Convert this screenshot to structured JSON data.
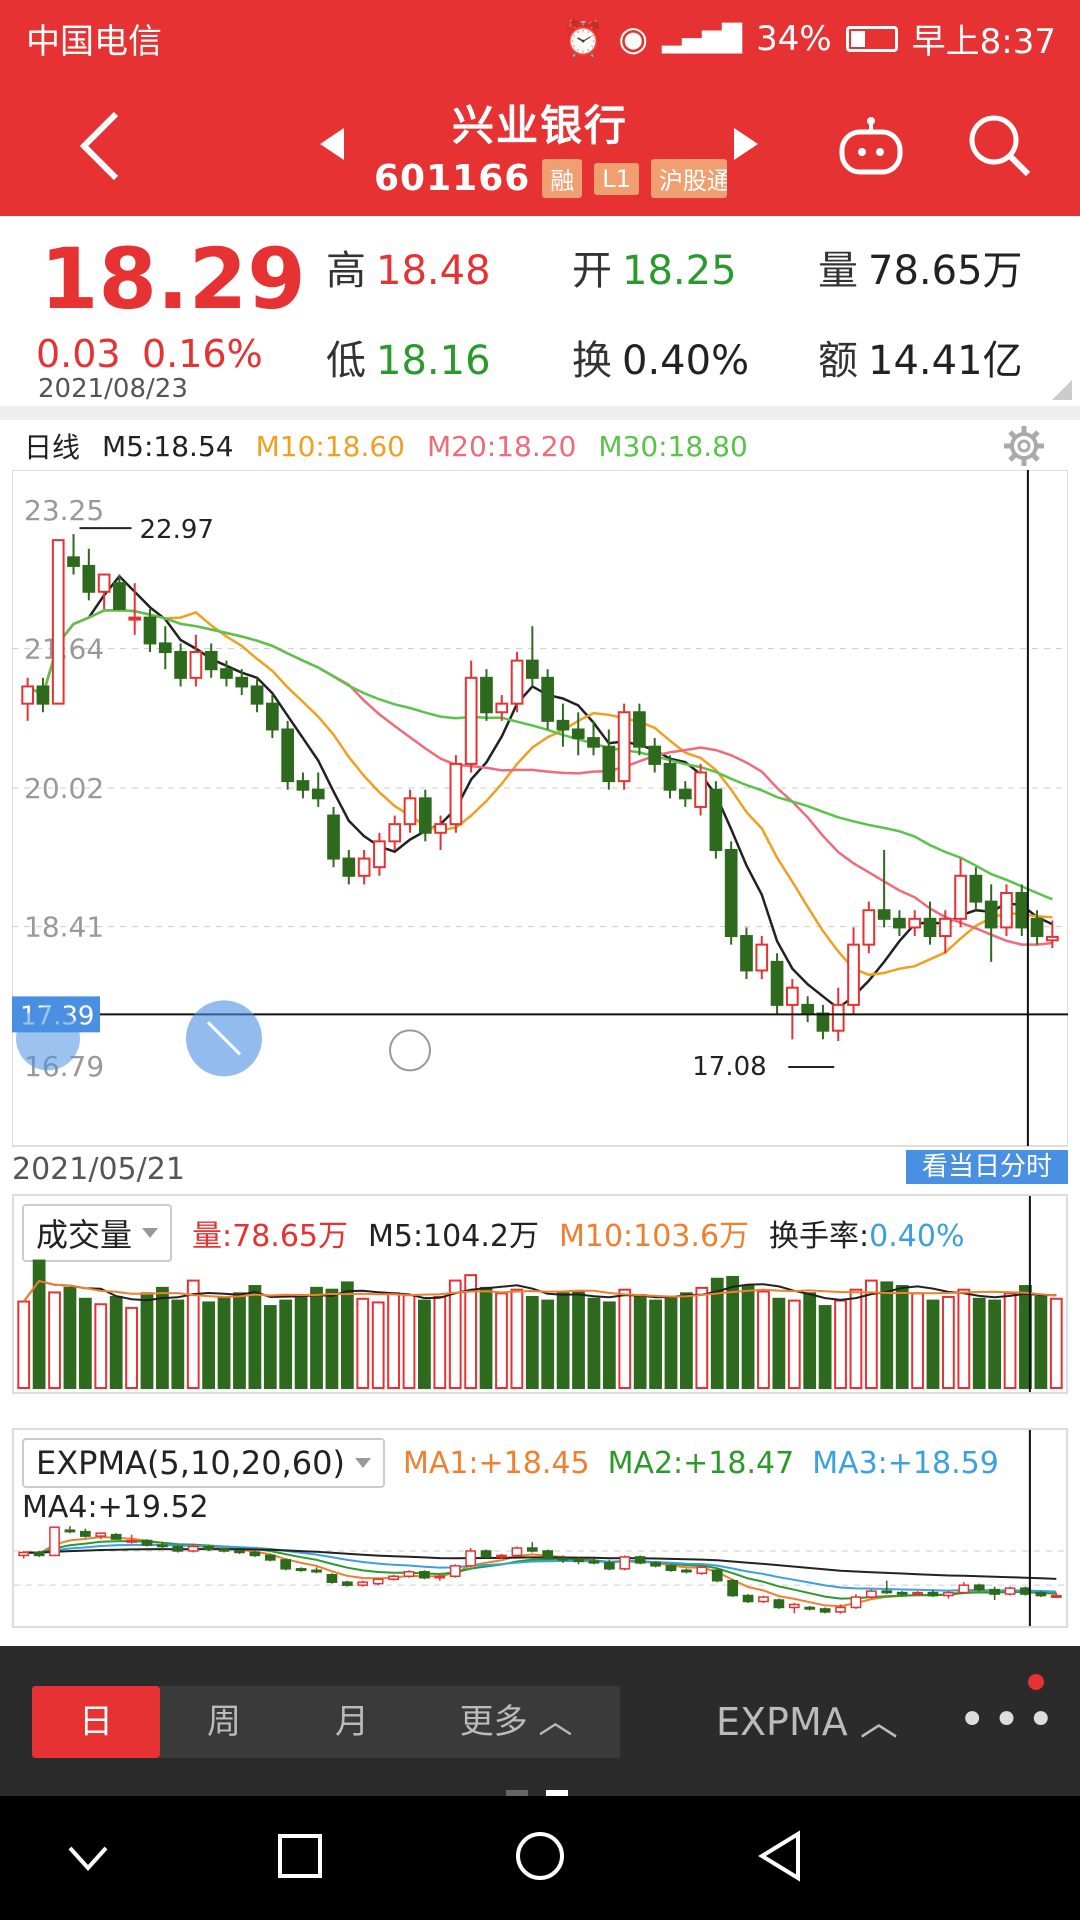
{
  "status": {
    "carrier": "中国电信",
    "battery": "34%",
    "time": "早上8:37"
  },
  "header": {
    "name": "兴业银行",
    "code": "601166",
    "tags": [
      "融",
      "L1",
      "沪股通"
    ]
  },
  "quote": {
    "price": "18.29",
    "change": "0.03",
    "change_pct": "0.16%",
    "date": "2021/08/23",
    "high_label": "高",
    "high": "18.48",
    "open_label": "开",
    "open": "18.25",
    "vol_label": "量",
    "vol": "78.65万",
    "low_label": "低",
    "low": "18.16",
    "turn_label": "换",
    "turn": "0.40%",
    "amt_label": "额",
    "amt": "14.41亿"
  },
  "kline": {
    "period": "日线",
    "m5": "M5:18.54",
    "m10": "M10:18.60",
    "m20": "M20:18.20",
    "m30": "M30:18.80",
    "y_labels": [
      "23.25",
      "21.64",
      "20.02",
      "18.41",
      "16.79"
    ],
    "max_label": "22.97",
    "min_label": "17.08",
    "cursor_price": "17.39",
    "start_date": "2021/05/21",
    "intraday_btn": "看当日分时",
    "colors": {
      "m5": "#222222",
      "m10": "#f0a020",
      "m20": "#f06b7a",
      "m30": "#5ac44a"
    }
  },
  "volume": {
    "selector": "成交量",
    "vol": "量:78.65万",
    "m5": "M5:104.2万",
    "m10": "M10:103.6万",
    "turn_label": "换手率:",
    "turn": "0.40%"
  },
  "expma": {
    "selector": "EXPMA(5,10,20,60)",
    "ma1": "MA1:+18.45",
    "ma2": "MA2:+18.47",
    "ma3": "MA3:+18.59",
    "ma4": "MA4:+19.52"
  },
  "bottom": {
    "day": "日",
    "week": "周",
    "month": "月",
    "more": "更多",
    "indicator": "EXPMA"
  },
  "chart_data": {
    "type": "candlestick",
    "title": "",
    "ylim": [
      16.79,
      23.25
    ],
    "y_ticks": [
      23.25,
      21.64,
      20.02,
      18.41,
      16.79
    ],
    "candles": [
      [
        21.0,
        21.3,
        20.8,
        21.2
      ],
      [
        21.2,
        21.3,
        20.9,
        21.0
      ],
      [
        21.0,
        22.9,
        21.0,
        22.9
      ],
      [
        22.7,
        22.97,
        22.5,
        22.6
      ],
      [
        22.6,
        22.8,
        22.2,
        22.3
      ],
      [
        22.3,
        22.5,
        22.1,
        22.5
      ],
      [
        22.4,
        22.5,
        22.1,
        22.1
      ],
      [
        22.0,
        22.4,
        21.8,
        22.0
      ],
      [
        22.0,
        22.1,
        21.6,
        21.7
      ],
      [
        21.7,
        21.9,
        21.4,
        21.6
      ],
      [
        21.6,
        21.7,
        21.2,
        21.3
      ],
      [
        21.3,
        21.8,
        21.2,
        21.6
      ],
      [
        21.6,
        21.7,
        21.3,
        21.4
      ],
      [
        21.4,
        21.5,
        21.2,
        21.3
      ],
      [
        21.3,
        21.4,
        21.1,
        21.2
      ],
      [
        21.2,
        21.3,
        20.9,
        21.0
      ],
      [
        21.0,
        21.1,
        20.6,
        20.7
      ],
      [
        20.7,
        20.8,
        20.0,
        20.1
      ],
      [
        20.1,
        20.2,
        19.9,
        20.0
      ],
      [
        20.0,
        20.2,
        19.8,
        19.9
      ],
      [
        19.7,
        19.8,
        19.1,
        19.2
      ],
      [
        19.2,
        19.3,
        18.9,
        19.0
      ],
      [
        19.0,
        19.3,
        18.9,
        19.2
      ],
      [
        19.1,
        19.5,
        19.0,
        19.4
      ],
      [
        19.4,
        19.7,
        19.3,
        19.6
      ],
      [
        19.6,
        20.0,
        19.5,
        19.9
      ],
      [
        19.9,
        20.0,
        19.4,
        19.5
      ],
      [
        19.5,
        19.7,
        19.3,
        19.6
      ],
      [
        19.6,
        20.4,
        19.5,
        20.3
      ],
      [
        20.3,
        21.5,
        20.2,
        21.3
      ],
      [
        21.3,
        21.4,
        20.8,
        20.9
      ],
      [
        20.9,
        21.1,
        20.8,
        21.0
      ],
      [
        21.0,
        21.6,
        20.9,
        21.5
      ],
      [
        21.5,
        21.9,
        21.2,
        21.3
      ],
      [
        21.3,
        21.4,
        20.7,
        20.8
      ],
      [
        20.8,
        21.0,
        20.5,
        20.7
      ],
      [
        20.7,
        20.9,
        20.4,
        20.6
      ],
      [
        20.6,
        20.8,
        20.4,
        20.5
      ],
      [
        20.5,
        20.7,
        20.0,
        20.1
      ],
      [
        20.1,
        21.0,
        20.0,
        20.9
      ],
      [
        20.9,
        21.0,
        20.4,
        20.5
      ],
      [
        20.5,
        20.6,
        20.2,
        20.3
      ],
      [
        20.3,
        20.4,
        19.9,
        20.0
      ],
      [
        20.0,
        20.1,
        19.8,
        19.9
      ],
      [
        19.8,
        20.3,
        19.7,
        20.2
      ],
      [
        20.0,
        20.1,
        19.2,
        19.3
      ],
      [
        19.3,
        19.4,
        18.2,
        18.3
      ],
      [
        18.3,
        18.4,
        17.8,
        17.9
      ],
      [
        17.9,
        18.3,
        17.8,
        18.2
      ],
      [
        18.0,
        18.1,
        17.4,
        17.5
      ],
      [
        17.5,
        17.8,
        17.1,
        17.7
      ],
      [
        17.5,
        17.6,
        17.3,
        17.4
      ],
      [
        17.4,
        17.5,
        17.1,
        17.2
      ],
      [
        17.2,
        17.7,
        17.08,
        17.5
      ],
      [
        17.5,
        18.4,
        17.4,
        18.2
      ],
      [
        18.2,
        18.7,
        18.1,
        18.6
      ],
      [
        18.6,
        19.3,
        18.4,
        18.5
      ],
      [
        18.5,
        18.6,
        18.3,
        18.4
      ],
      [
        18.4,
        18.6,
        18.3,
        18.5
      ],
      [
        18.5,
        18.7,
        18.2,
        18.3
      ],
      [
        18.3,
        18.6,
        18.1,
        18.5
      ],
      [
        18.5,
        19.2,
        18.4,
        19.0
      ],
      [
        19.0,
        19.1,
        18.6,
        18.7
      ],
      [
        18.7,
        18.9,
        18.0,
        18.4
      ],
      [
        18.4,
        18.9,
        18.3,
        18.8
      ],
      [
        18.8,
        18.9,
        18.3,
        18.4
      ],
      [
        18.5,
        18.6,
        18.2,
        18.3
      ],
      [
        18.25,
        18.48,
        18.16,
        18.29
      ]
    ],
    "volume": [
      95,
      140,
      105,
      110,
      98,
      92,
      100,
      88,
      104,
      110,
      96,
      118,
      94,
      100,
      104,
      112,
      90,
      96,
      102,
      110,
      108,
      116,
      98,
      94,
      104,
      102,
      96,
      100,
      118,
      124,
      110,
      104,
      108,
      100,
      96,
      104,
      106,
      98,
      94,
      108,
      102,
      96,
      100,
      104,
      110,
      120,
      122,
      112,
      106,
      98,
      96,
      104,
      90,
      96,
      108,
      118,
      116,
      112,
      104,
      96,
      100,
      108,
      98,
      96,
      104,
      112,
      100,
      98
    ]
  }
}
